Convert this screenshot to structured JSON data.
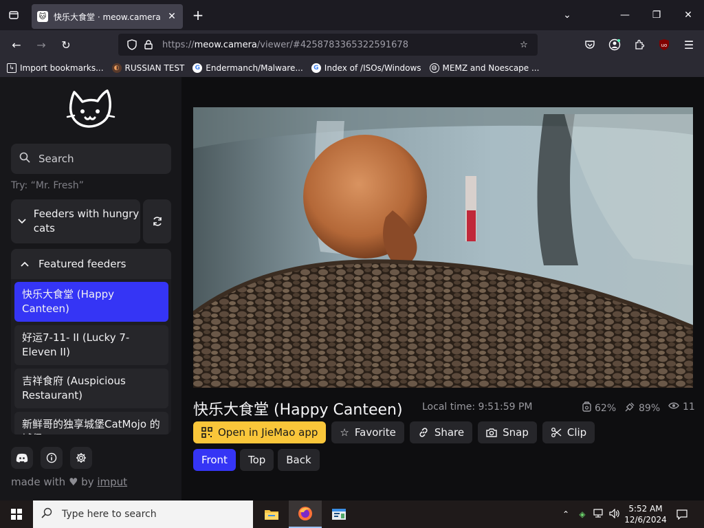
{
  "browser": {
    "tab_title": "快乐大食堂 · meow.camera",
    "url_prefix": "https://",
    "url_domain": "meow.camera",
    "url_rest": "/viewer/#4258783365322591678",
    "bookmarks": [
      "Import bookmarks...",
      "RUSSIAN TEST",
      "Endermanch/Malware...",
      "Index of /ISOs/Windows",
      "MEMZ and Noescape ..."
    ]
  },
  "sidebar": {
    "search_placeholder": "Search",
    "try_hint": "Try: “Mr. Fresh”",
    "section_hungry": "Feeders with hungry cats",
    "section_featured": "Featured feeders",
    "feeders": [
      {
        "label": "快乐大食堂 (Happy Canteen)",
        "active": true
      },
      {
        "label": "好运7-11- II  (Lucky 7-Eleven II)",
        "active": false
      },
      {
        "label": "吉祥食府 (Auspicious Restaurant)",
        "active": false
      },
      {
        "label": "新鲜哥的独享城堡CatMojo 的城堡",
        "active": false
      }
    ],
    "made_with": "made with",
    "by": "by",
    "author": "imput"
  },
  "viewer": {
    "title": "快乐大食堂 (Happy Canteen)",
    "local_time": "Local time: 9:51:59 PM",
    "stat_food": "62%",
    "stat_signal": "89%",
    "stat_viewers": "11",
    "buttons": {
      "open_app": "Open in JieMao app",
      "favorite": "Favorite",
      "share": "Share",
      "snap": "Snap",
      "clip": "Clip"
    },
    "cameras": [
      "Front",
      "Top",
      "Back"
    ],
    "active_camera": "Front"
  },
  "taskbar": {
    "search_placeholder": "Type here to search",
    "time": "5:52 AM",
    "date": "12/6/2024"
  },
  "colors": {
    "accent_blue": "#3535f5",
    "accent_yellow": "#f9c63a"
  }
}
